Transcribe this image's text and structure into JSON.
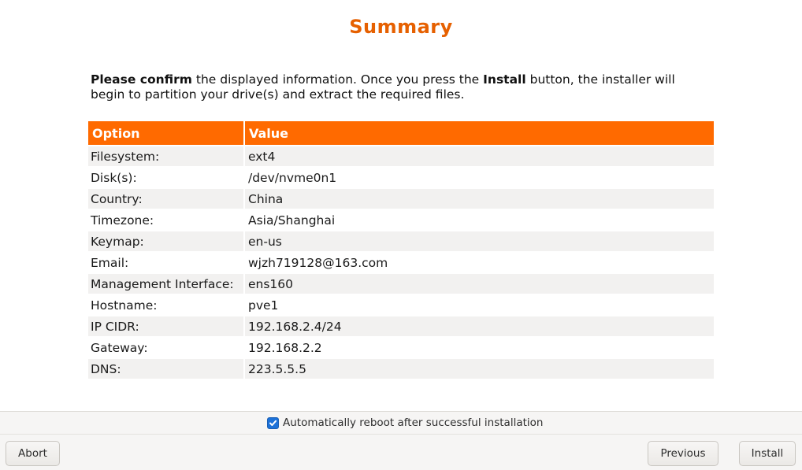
{
  "page": {
    "title": "Summary",
    "intro": {
      "bold1": "Please confirm",
      "text1": " the displayed information. Once you press the ",
      "bold2": "Install",
      "text2": " button, the installer will begin to partition your drive(s) and extract the required files."
    }
  },
  "table": {
    "headers": [
      "Option",
      "Value"
    ],
    "rows": [
      {
        "option": "Filesystem:",
        "value": "ext4"
      },
      {
        "option": "Disk(s):",
        "value": "/dev/nvme0n1"
      },
      {
        "option": "Country:",
        "value": "China"
      },
      {
        "option": "Timezone:",
        "value": "Asia/Shanghai"
      },
      {
        "option": "Keymap:",
        "value": "en-us"
      },
      {
        "option": "Email:",
        "value": "wjzh719128@163.com"
      },
      {
        "option": "Management Interface:",
        "value": "ens160"
      },
      {
        "option": "Hostname:",
        "value": "pve1"
      },
      {
        "option": "IP CIDR:",
        "value": "192.168.2.4/24"
      },
      {
        "option": "Gateway:",
        "value": "192.168.2.2"
      },
      {
        "option": "DNS:",
        "value": "223.5.5.5"
      }
    ]
  },
  "footer": {
    "reboot_label": "Automatically reboot after successful installation",
    "reboot_checked": true,
    "abort_label": "Abort",
    "previous_label": "Previous",
    "install_label": "Install"
  },
  "colors": {
    "accent": "#ff6a00",
    "title": "#e66000",
    "checkbox": "#1c71d8"
  }
}
